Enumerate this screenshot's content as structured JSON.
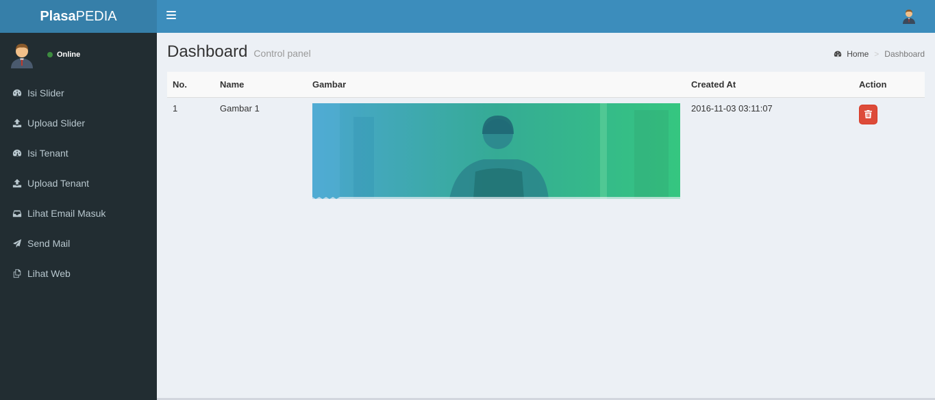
{
  "brand": {
    "bold": "Plasa",
    "light": "PEDIA"
  },
  "user": {
    "status": "Online"
  },
  "sidebar": {
    "items": [
      {
        "label": "Isi Slider",
        "icon": "dashboard-icon"
      },
      {
        "label": "Upload Slider",
        "icon": "upload-icon"
      },
      {
        "label": "Isi Tenant",
        "icon": "dashboard-icon"
      },
      {
        "label": "Upload Tenant",
        "icon": "upload-icon"
      },
      {
        "label": "Lihat Email Masuk",
        "icon": "inbox-icon"
      },
      {
        "label": "Send Mail",
        "icon": "paper-plane-icon"
      },
      {
        "label": "Lihat Web",
        "icon": "copy-icon"
      }
    ]
  },
  "header": {
    "title": "Dashboard",
    "subtitle": "Control panel"
  },
  "breadcrumb": {
    "home": "Home",
    "current": "Dashboard",
    "separator": ">"
  },
  "table": {
    "columns": [
      "No.",
      "Name",
      "Gambar",
      "Created At",
      "Action"
    ],
    "rows": [
      {
        "no": "1",
        "name": "Gambar 1",
        "created_at": "2016-11-03 03:11:07"
      }
    ]
  },
  "colors": {
    "header": "#3c8dbc",
    "logo": "#367fa9",
    "sidebar": "#222d32",
    "danger": "#dd4b39"
  }
}
